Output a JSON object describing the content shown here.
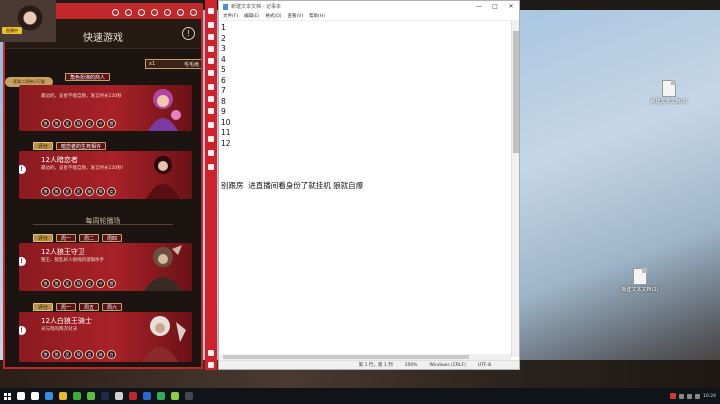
{
  "game": {
    "title": "快速游戏",
    "help_glyph": "!",
    "room": {
      "multiplier": "x1",
      "owner": "毛毛雨"
    },
    "mini_label": "逐渐二哥带小可爱",
    "section_title": "每周轮播场",
    "cards": [
      {
        "tags": [
          "角色扮演的商人"
        ],
        "name": "",
        "desc": "最边的，妥星不能自救，发言时长120秒",
        "roles": [
          "狼",
          "狼",
          "民",
          "预",
          "女",
          "守",
          "猎"
        ]
      },
      {
        "tags": [
          "评分",
          "暗恋者的生死相许"
        ],
        "name": "12人暗恋者",
        "desc": "最边的，妥星不能自救，发言时长120秒!",
        "roles": [
          "狼",
          "狼",
          "民",
          "民",
          "暗",
          "预",
          "女"
        ]
      },
      {
        "tags": [
          "评分",
          "周一",
          "周二",
          "周四"
        ],
        "name": "12人狼王守卫",
        "desc": "狼王、狼乱好人视线的逻辑杀手",
        "roles": [
          "狼",
          "狼",
          "民",
          "预",
          "女",
          "守",
          "猎"
        ]
      },
      {
        "tags": [
          "评分",
          "周一",
          "周五",
          "周六"
        ],
        "name": "12人白狼王骑士",
        "desc": "光与暗的两次对决",
        "roles": [
          "狼",
          "狼",
          "民",
          "预",
          "女",
          "骑",
          "白"
        ]
      }
    ]
  },
  "notepad": {
    "title": "新建文本文档 - 记事本",
    "menu": [
      "文件(F)",
      "编辑(E)",
      "格式(O)",
      "查看(V)",
      "帮助(H)"
    ],
    "controls": [
      "—",
      "□",
      "✕"
    ],
    "lines": [
      "1",
      "2",
      "3",
      "4",
      "5",
      "6",
      "7",
      "8",
      "9",
      "10",
      "11",
      "12",
      "",
      "",
      "",
      "别跟房  进直播间看身份了就挂机 狼就自爆"
    ],
    "status": [
      "第 1 行，第 1 列",
      "100%",
      "Windows (CRLF)",
      "UTF-8"
    ]
  },
  "desktop": {
    "icons": [
      {
        "label": "新建文本文档(3)"
      },
      {
        "label": "新建文本文档(2)"
      }
    ]
  },
  "webcam_badge": "直播中",
  "taskbar": {
    "apps": [
      {
        "name": "search",
        "color": "#ffffff"
      },
      {
        "name": "task-view",
        "color": "#ffffff"
      },
      {
        "name": "edge",
        "color": "#3c8ce0"
      },
      {
        "name": "explorer",
        "color": "#e8b830"
      },
      {
        "name": "wechat",
        "color": "#3cb034"
      },
      {
        "name": "app-green",
        "color": "#58c040"
      },
      {
        "name": "steam",
        "color": "#1a2a4a"
      },
      {
        "name": "app-sq",
        "color": "#d0d0d0"
      },
      {
        "name": "app-red",
        "color": "#c02828"
      },
      {
        "name": "app-blue",
        "color": "#2a6ad0"
      },
      {
        "name": "app-green2",
        "color": "#30b050"
      },
      {
        "name": "app-lime",
        "color": "#8ad040"
      },
      {
        "name": "app-dark",
        "color": "#404850"
      }
    ],
    "time": "10:24"
  }
}
